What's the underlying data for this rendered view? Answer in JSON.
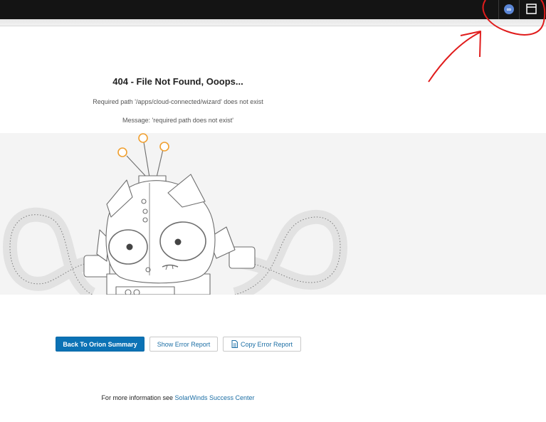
{
  "error": {
    "title": "404 - File Not Found, Ooops...",
    "path_message": "Required path '/apps/cloud-connected/wizard' does not exist",
    "detail_message": "Message: 'required path does not exist'"
  },
  "buttons": {
    "back": "Back To Orion Summary",
    "show_report": "Show Error Report",
    "copy_report": "Copy Error Report"
  },
  "footer": {
    "prefix": "For more information see",
    "link": "SolarWinds Success Center"
  },
  "icons": {
    "status": "status-icon",
    "window": "window-icon",
    "document": "document-icon"
  },
  "colors": {
    "primary_button": "#0b72b5",
    "link": "#1d6fa5",
    "annotation": "#e01c1c",
    "antenna": "#f0a030"
  }
}
